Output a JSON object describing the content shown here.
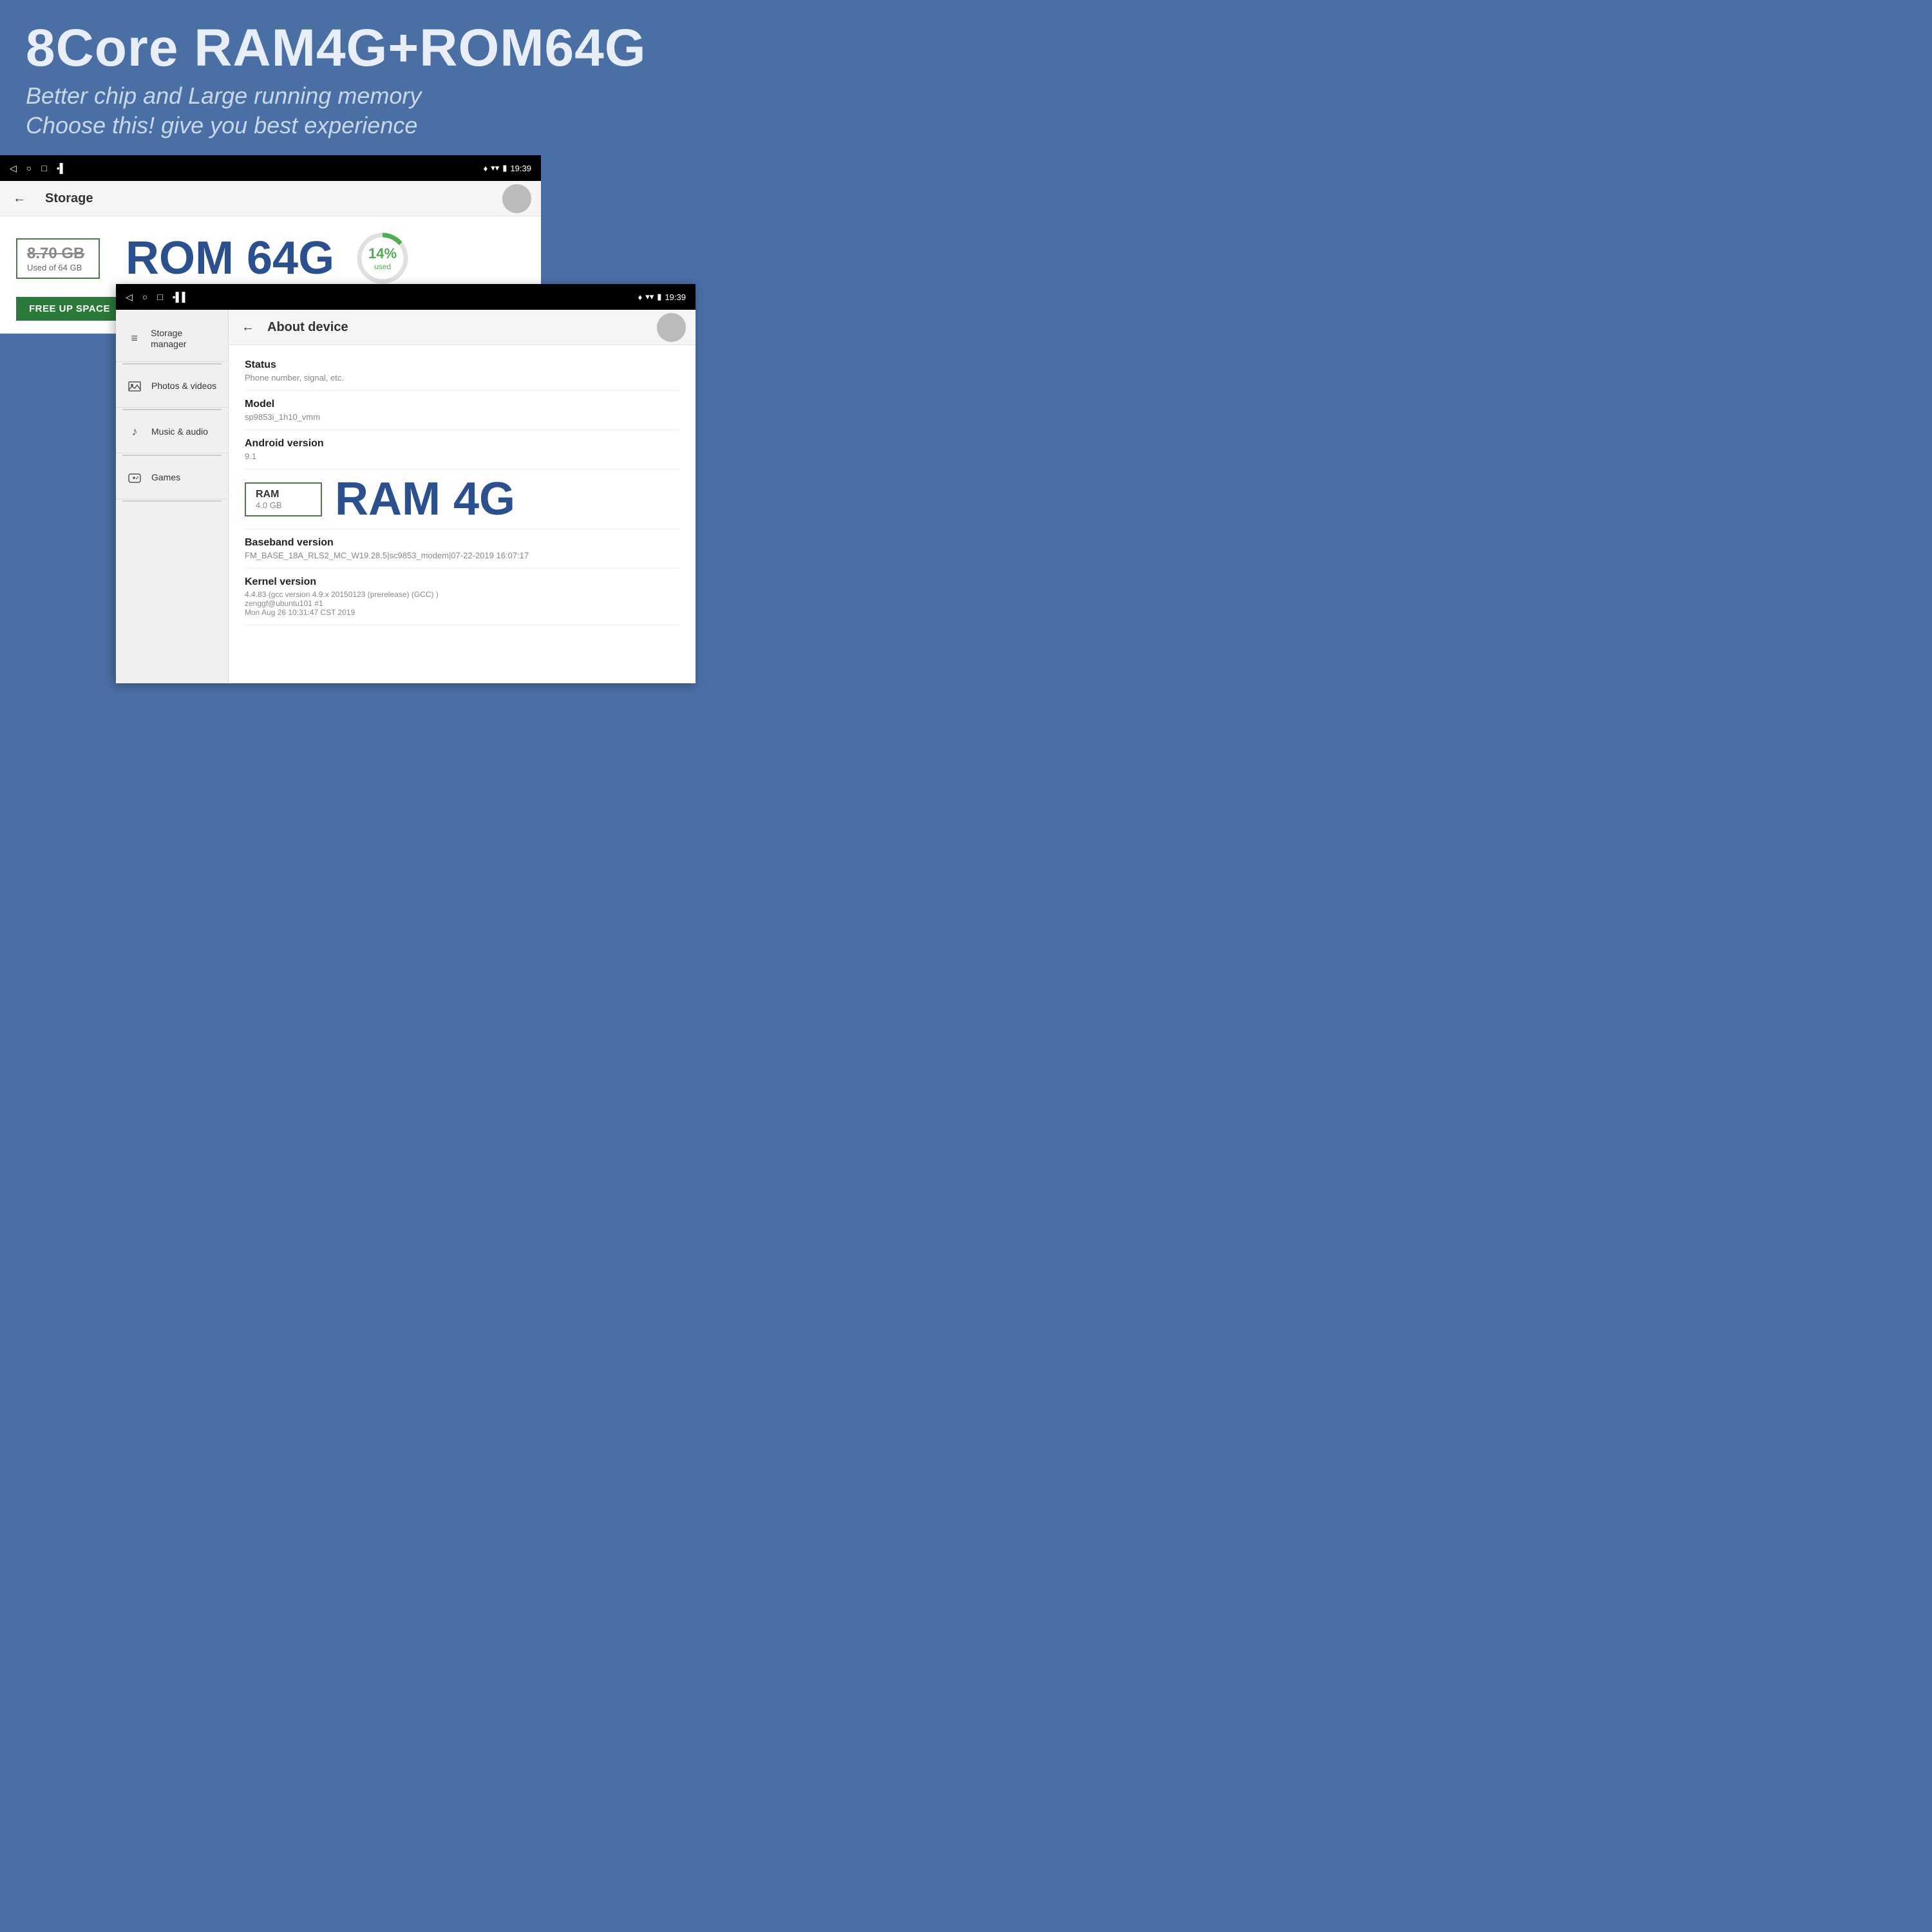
{
  "header": {
    "title": "8Core RAM4G+ROM64G",
    "subtitle1": "Better chip and Large running memory",
    "subtitle2": "Choose this!   give you best experience"
  },
  "screen1": {
    "status_bar": {
      "time": "19:39",
      "left_icons": [
        "◁",
        "○",
        "□",
        "•▌"
      ]
    },
    "nav": {
      "back": "←",
      "title": "Storage"
    },
    "storage": {
      "used_amount": "8.70 GB",
      "used_label": "Used of 64 GB",
      "rom_label": "ROM 64G",
      "percent": "14%",
      "percent_label": "used",
      "free_up_btn": "FREE UP SPACE"
    }
  },
  "screen2": {
    "status_bar": {
      "time": "19:39",
      "left_icons": [
        "◁",
        "○",
        "□",
        "•▌▌"
      ]
    },
    "sidebar": {
      "items": [
        {
          "icon": "≡",
          "label": "Storage manager"
        },
        {
          "icon": "🖼",
          "label": "Photos & videos"
        },
        {
          "icon": "♪",
          "label": "Music & audio"
        },
        {
          "icon": "+",
          "label": "Games"
        }
      ]
    },
    "about": {
      "nav_back": "←",
      "title": "About device",
      "rows": [
        {
          "title": "Status",
          "value": "Phone number, signal, etc."
        },
        {
          "title": "Model",
          "value": "sp9853i_1h10_vmm"
        },
        {
          "title": "Android version",
          "value": "9.1"
        }
      ],
      "ram": {
        "box_title": "RAM",
        "box_value": "4.0 GB",
        "label": "RAM 4G"
      },
      "baseband": {
        "title": "Baseband version",
        "value": "FM_BASE_18A_RLS2_MC_W19.28.5|sc9853_modem|07-22-2019 16:07:17"
      },
      "kernel": {
        "title": "Kernel version",
        "value": "4.4.83 (gcc version 4.9.x 20150123 (prerelease) (GCC) )\nzenggf@ubuntu101 #1\nMon Aug 26 10:31:47 CST 2019"
      }
    }
  }
}
